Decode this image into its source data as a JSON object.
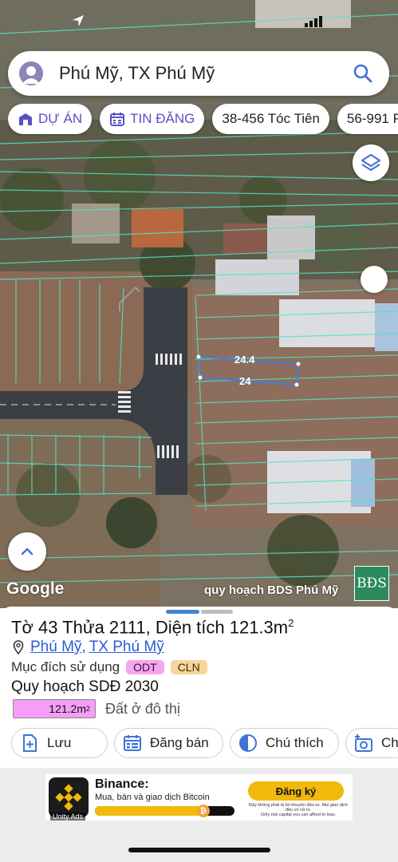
{
  "search": {
    "query": "Phú Mỹ, TX Phú Mỹ"
  },
  "chips": [
    {
      "label": "DỰ ÁN",
      "icon": "building-icon"
    },
    {
      "label": "TIN ĐĂNG",
      "icon": "calendar-icon"
    },
    {
      "label": "38-456 Tóc Tiên"
    },
    {
      "label": "56-991 P"
    }
  ],
  "map": {
    "parcel_width_top": "24.4",
    "parcel_width_bottom": "24",
    "attribution": "Google",
    "watermark": "quy hoạch BDS Phú Mỹ",
    "brand_logo": "BĐS"
  },
  "parcel": {
    "title": "Tờ 43 Thửa 2111, Diện tích 121.3m",
    "title_sup": "2",
    "location_ward": "Phú Mỹ",
    "location_separator": ",",
    "location_town": "TX Phú Mỹ",
    "purpose_label": "Mục đích sử dụng",
    "purpose_tags": [
      "ODT",
      "CLN"
    ],
    "plan_title": "Quy hoạch SDĐ 2030",
    "plan_area": "121.2m",
    "plan_area_sup": "2",
    "plan_desc": "Đất ở đô thị"
  },
  "actions": [
    {
      "label": "Lưu",
      "icon": "plus-doc-icon"
    },
    {
      "label": "Đăng bán",
      "icon": "calendar-list-icon"
    },
    {
      "label": "Chú thích",
      "icon": "half-circle-icon"
    },
    {
      "label": "Ch",
      "icon": "add-photo-icon"
    }
  ],
  "ad": {
    "title": "Binance:",
    "subtitle": "Mua, bán và giao dịch Bitcoin",
    "cta": "Đăng ký",
    "disclaimer_line1": "Đây không phải là lời khuyên đầu tư. Mọi giao dịch đều có rủi ro.",
    "disclaimer_line2": "Only risk capital you can afford to lose.",
    "network": "Unity Ads",
    "progress": 0.78
  },
  "colors": {
    "accent": "#5b4fc4",
    "link": "#2a5bd7",
    "tag_odt": "#f4a6f0",
    "tag_cln": "#f6d49c",
    "plan_fill": "#f59ef7",
    "parcel_outline": "#3f7fe0",
    "binance_yellow": "#f0b90b"
  }
}
